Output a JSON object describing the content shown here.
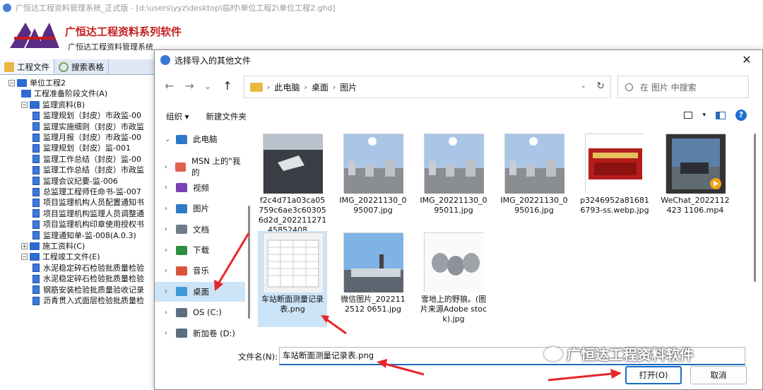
{
  "app": {
    "title": "广恒达工程资料管理系统_正式版 - [d:\\users\\yyz\\desktop\\临时\\单位工程2\\单位工程2.ghd]",
    "brand": "广恒达工程资料系列软件",
    "brand_sub": "广恒达工程资料管理系统"
  },
  "tabs": [
    {
      "label": "工程文件",
      "icon": "folder-icon"
    },
    {
      "label": "搜索表格",
      "icon": "search-icon"
    }
  ],
  "tree": [
    {
      "label": "单位工程2",
      "level": 0,
      "type": "root",
      "expander": "−"
    },
    {
      "label": "工程准备阶段文件(A)",
      "level": 1,
      "type": "book",
      "expander": ""
    },
    {
      "label": "监理资料(B)",
      "level": 1,
      "type": "book",
      "expander": "−"
    },
    {
      "label": "监理规划（封皮）市政监-00",
      "level": 2,
      "type": "doc"
    },
    {
      "label": "监理实施细则（封皮）市政监",
      "level": 2,
      "type": "doc"
    },
    {
      "label": "监理月报（封皮）市政监-00",
      "level": 2,
      "type": "doc"
    },
    {
      "label": "监理规划（封皮）监-001",
      "level": 2,
      "type": "doc"
    },
    {
      "label": "监理工作总结（封皮）监-00",
      "level": 2,
      "type": "doc"
    },
    {
      "label": "监理工作总结（封皮）市政监",
      "level": 2,
      "type": "doc"
    },
    {
      "label": "监理会议纪要-监-006",
      "level": 2,
      "type": "doc"
    },
    {
      "label": "总监理工程师任命书-监-007",
      "level": 2,
      "type": "doc"
    },
    {
      "label": "项目监理机构人员配置通知书",
      "level": 2,
      "type": "doc"
    },
    {
      "label": "项目监理机构监理人员调整通",
      "level": 2,
      "type": "doc"
    },
    {
      "label": "项目监理机构印章使用授权书",
      "level": 2,
      "type": "doc"
    },
    {
      "label": "监理通知单-监-008(A.0.3)",
      "level": 2,
      "type": "doc"
    },
    {
      "label": "施工资料(C)",
      "level": 1,
      "type": "book",
      "expander": "+"
    },
    {
      "label": "工程竣工文件(E)",
      "level": 1,
      "type": "book",
      "expander": "−"
    },
    {
      "label": "水泥稳定碎石检验批质量检验",
      "level": 2,
      "type": "doc"
    },
    {
      "label": "水泥稳定碎石检验批质量检验",
      "level": 2,
      "type": "doc"
    },
    {
      "label": "钢筋安装检验批质量验收记录",
      "level": 2,
      "type": "doc"
    },
    {
      "label": "沥青贯入式面层检验批质量检",
      "level": 2,
      "type": "doc"
    }
  ],
  "dialog": {
    "title": "选择导入的其他文件",
    "close": "✕",
    "nav": {
      "back": "←",
      "forward": "→",
      "recent": "⌄",
      "up": "↑"
    },
    "breadcrumb": [
      "此电脑",
      "桌面",
      "图片"
    ],
    "search_placeholder": "在 图片 中搜索",
    "organize": "组织 ▾",
    "new_folder": "新建文件夹",
    "help": "?",
    "nav_items": [
      {
        "label": "此电脑",
        "icon": "computer-icon",
        "color": "#2f78c9",
        "chev": "⌄"
      },
      {
        "label": "MSN 上的\"我的",
        "icon": "msn-icon",
        "color": "#e0604e",
        "chev": "›"
      },
      {
        "label": "视频",
        "icon": "video-icon",
        "color": "#7b3fb8",
        "chev": "›"
      },
      {
        "label": "图片",
        "icon": "pictures-icon",
        "color": "#2f7ac2",
        "chev": "›"
      },
      {
        "label": "文档",
        "icon": "documents-icon",
        "color": "#6f7d8c",
        "chev": "›"
      },
      {
        "label": "下载",
        "icon": "downloads-icon",
        "color": "#2e8d3e",
        "chev": "›"
      },
      {
        "label": "音乐",
        "icon": "music-icon",
        "color": "#d8553a",
        "chev": "›"
      },
      {
        "label": "桌面",
        "icon": "desktop-icon",
        "color": "#3c9ad8",
        "chev": "›",
        "selected": true
      },
      {
        "label": "OS (C:)",
        "icon": "drive-icon",
        "color": "#5c6e80",
        "chev": "›"
      },
      {
        "label": "新加卷 (D:)",
        "icon": "drive-icon",
        "color": "#5c6e80",
        "chev": "›"
      }
    ],
    "files": [
      {
        "label": "f2c4d71a03ca05759c6ae3c603056d2d_20221127145852408....",
        "thumb": "crowd"
      },
      {
        "label": "IMG_20221130_095007.jpg",
        "thumb": "city"
      },
      {
        "label": "IMG_20221130_095011.jpg",
        "thumb": "city"
      },
      {
        "label": "IMG_20221130_095016.jpg",
        "thumb": "city"
      },
      {
        "label": "p3246952a816816793-ss.webp.jpg",
        "thumb": "red"
      },
      {
        "label": "WeChat_2022112423 1106.mp4",
        "thumb": "video"
      },
      {
        "label": "车站断面测量记录表.png",
        "thumb": "table",
        "selected": true
      },
      {
        "label": "微信图片_2022112512 0651.jpg",
        "thumb": "sky"
      },
      {
        "label": "雪地上的野狼。(图片来源Adobe stock).jpg",
        "thumb": "wolves"
      }
    ],
    "filename_label": "文件名(N):",
    "filename_value": "车站断面测量记录表.png",
    "open_label": "打开(O)",
    "cancel_label": "取消"
  },
  "watermark": "广恒达工程资料软件",
  "colors": {
    "accent": "#1c6dc4",
    "arrow": "#e8262a",
    "selection": "#cce4f7"
  }
}
